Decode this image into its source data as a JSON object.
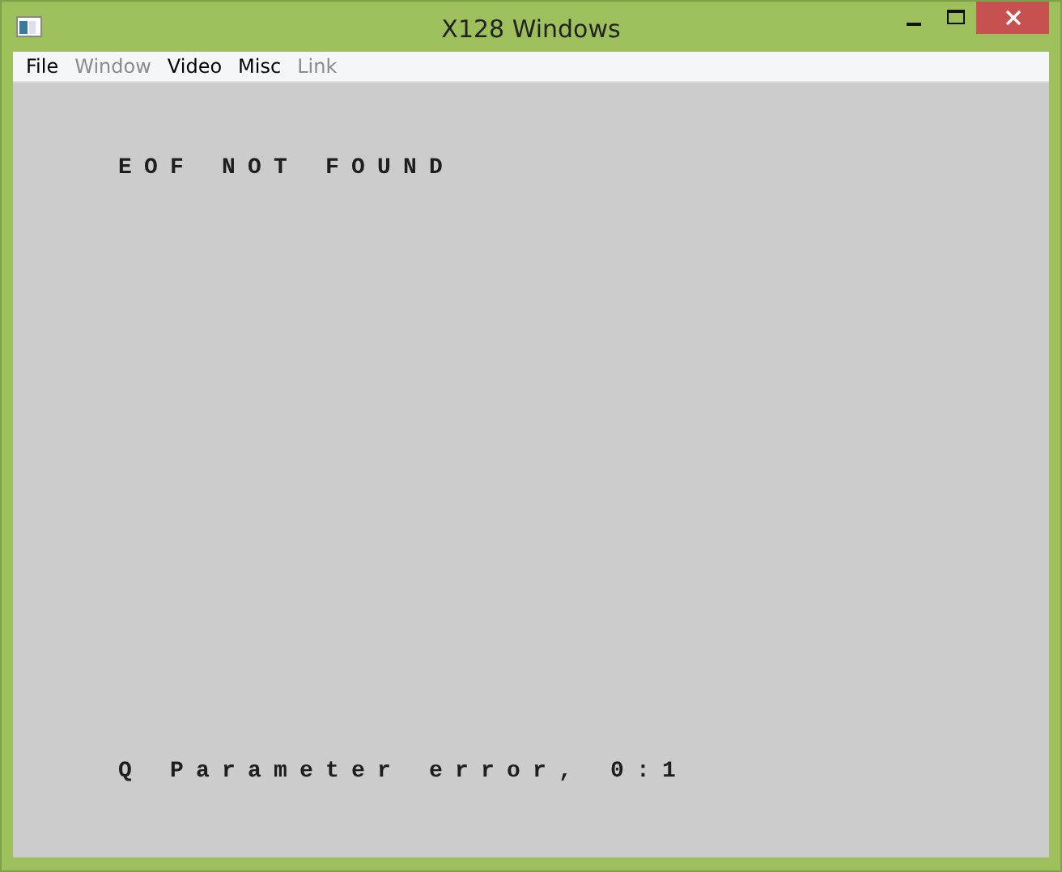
{
  "window": {
    "title": "X128 Windows"
  },
  "menu": [
    {
      "label": "File",
      "disabled": false
    },
    {
      "label": "Window",
      "disabled": true
    },
    {
      "label": "Video",
      "disabled": false
    },
    {
      "label": "Misc",
      "disabled": false
    },
    {
      "label": "Link",
      "disabled": true
    }
  ],
  "screen": {
    "lines": [
      "EOF NOT FOUND",
      "Q Parameter error, 0:1"
    ]
  }
}
